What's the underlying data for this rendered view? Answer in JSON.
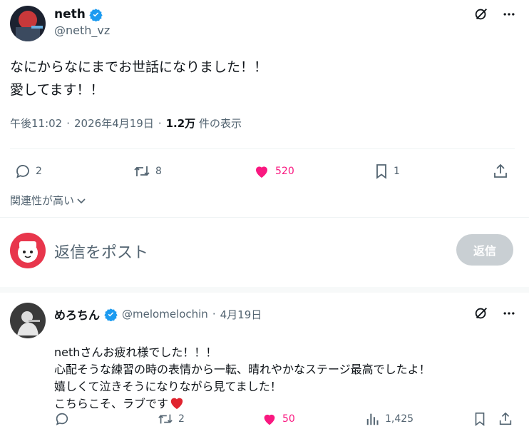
{
  "post": {
    "display_name": "neth",
    "handle": "@neth_vz",
    "text": "なにからなにまでお世話になりました！！\n愛してます！！",
    "time": "午後11:02",
    "date": "2026年4月19日",
    "views_count": "1.2万",
    "views_label": "件の表示",
    "sep": "·",
    "replies": "2",
    "reposts": "8",
    "likes": "520",
    "bookmarks": "1"
  },
  "sort": {
    "label": "関連性が高い"
  },
  "compose": {
    "placeholder": "返信をポスト",
    "button": "返信"
  },
  "reply": {
    "display_name": "めろちん",
    "handle": "@melomelochin",
    "sep": "·",
    "date": "4月19日",
    "text": "nethさんお疲れ様でした！！！\n心配そうな練習の時の表情から一転、晴れやかなステージ最高でしたよ！\n嬉しくて泣きそうになりながら見てました！\nこちらこそ、ラブです",
    "replies": "",
    "reposts": "2",
    "likes": "50",
    "views": "1,425"
  },
  "colors": {
    "accent": "#1d9bf0",
    "like": "#f91880",
    "muted": "#536471",
    "divider": "#eff3f4"
  }
}
